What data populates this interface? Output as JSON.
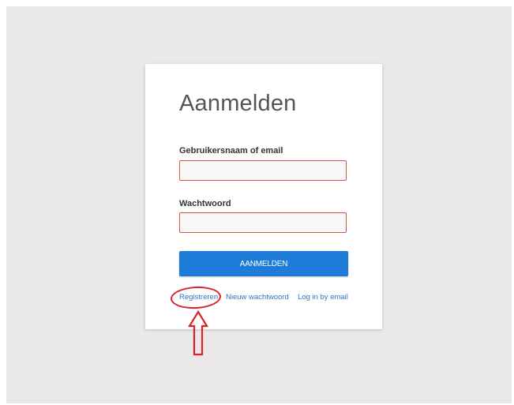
{
  "login": {
    "title": "Aanmelden",
    "username_label": "Gebruikersnaam of email",
    "username_value": "",
    "password_label": "Wachtwoord",
    "password_value": "",
    "submit_label": "AANMELDEN"
  },
  "links": {
    "register": "Registreren",
    "new_password": "Nieuw wachtwoord",
    "email_login": "Log in by email"
  },
  "annotation": {
    "color": "#d9232a",
    "icon": "up-arrow-icon"
  },
  "colors": {
    "primary_button": "#1e7bd8",
    "field_border_error": "#d9534f",
    "link": "#2f74c0",
    "background": "#ebe9e7"
  }
}
